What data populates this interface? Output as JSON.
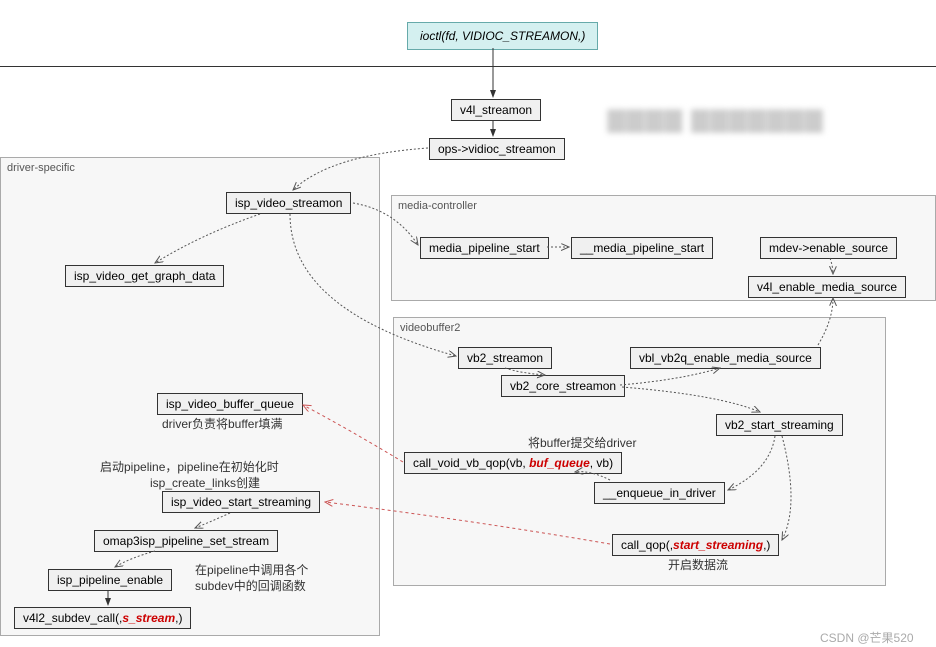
{
  "top": {
    "ioctl": "ioctl(fd, VIDIOC_STREAMON,)",
    "v4l_streamon": "v4l_streamon",
    "ops_vidioc": "ops->vidioc_streamon"
  },
  "driver": {
    "group": "driver-specific",
    "isp_video_streamon": "isp_video_streamon",
    "isp_video_get_graph_data": "isp_video_get_graph_data",
    "isp_video_buffer_queue": "isp_video_buffer_queue",
    "queue_note": "driver负责将buffer填满",
    "pipeline_note_1": "启动pipeline，pipeline在初始化时",
    "pipeline_note_2": "isp_create_links创建",
    "isp_video_start_streaming": "isp_video_start_streaming",
    "omap3isp_pipeline_set_stream": "omap3isp_pipeline_set_stream",
    "isp_pipeline_enable": "isp_pipeline_enable",
    "subdev_note_1": "在pipeline中调用各个",
    "subdev_note_2": "subdev中的回调函数",
    "v4l2_subdev_call_pre": "v4l2_subdev_call(,",
    "v4l2_subdev_call_red": "s_stream",
    "v4l2_subdev_call_post": ",)"
  },
  "media": {
    "group": "media-controller",
    "media_pipeline_start": "media_pipeline_start",
    "__media_pipeline_start": "__media_pipeline_start",
    "mdev_enable_source": "mdev->enable_source",
    "v4l_enable_media_source": "v4l_enable_media_source"
  },
  "vb2": {
    "group": "videobuffer2",
    "vb2_streamon": "vb2_streamon",
    "vbl_vb2q_enable_media_source": "vbl_vb2q_enable_media_source",
    "vb2_core_streamon": "vb2_core_streamon",
    "vb2_start_streaming": "vb2_start_streaming",
    "buf_note": "将buffer提交给driver",
    "call_void_pre": "call_void_vb_qop(vb, ",
    "call_void_red": "buf_queue",
    "call_void_post": ", vb)",
    "enqueue_in_driver": "__enqueue_in_driver",
    "call_qop_pre": "call_qop(,",
    "call_qop_red": "start_streaming",
    "call_qop_post": ",)",
    "stream_note": "开启数据流"
  },
  "watermark": "CSDN @芒果520",
  "watermark_blur": "▇▇▇▇   ▇▇▇▇▇▇▇"
}
